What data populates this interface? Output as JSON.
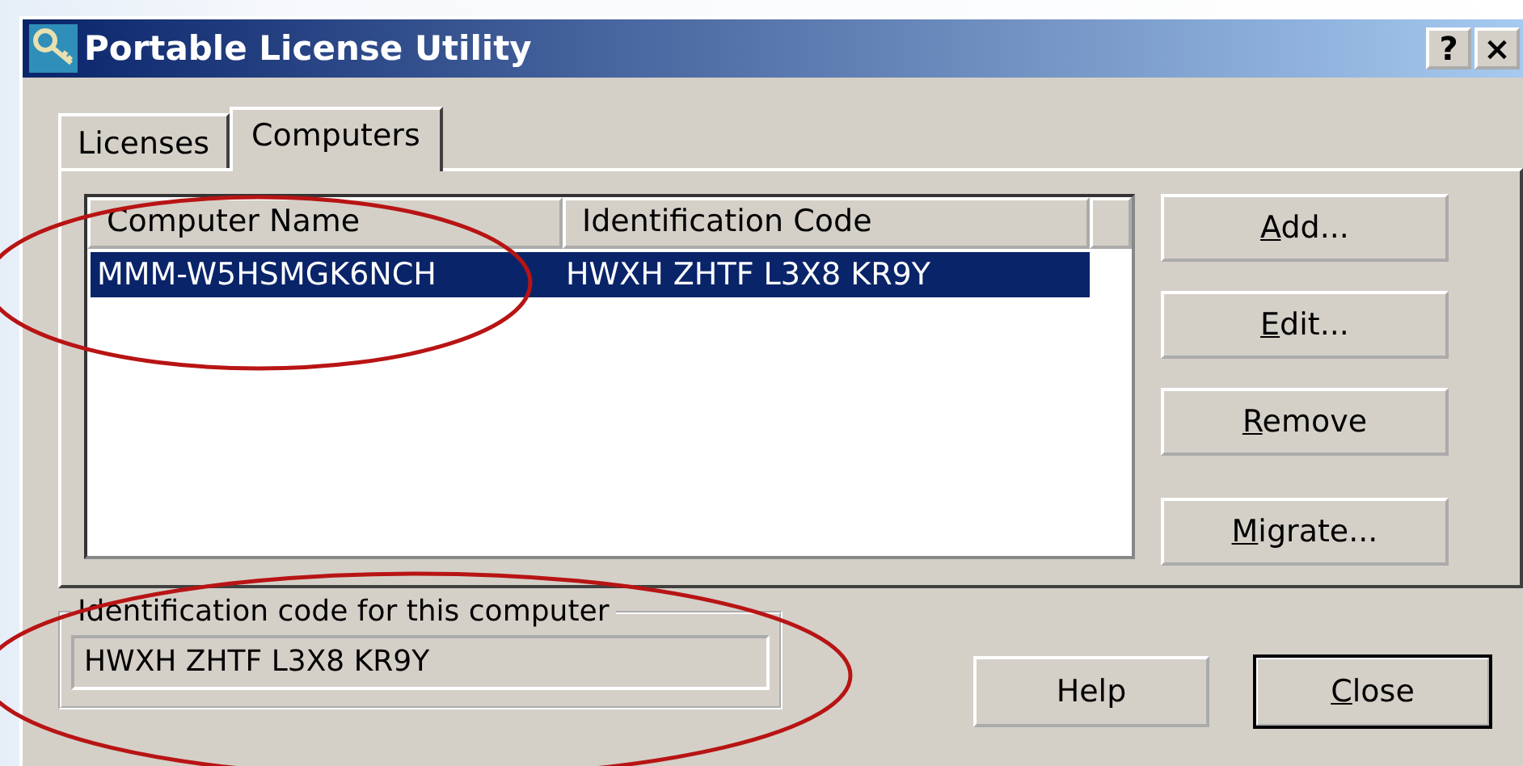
{
  "window": {
    "title": "Portable License Utility",
    "help_button": "?",
    "close_button": "×"
  },
  "tabs": [
    {
      "label": "Licenses",
      "selected": false
    },
    {
      "label": "Computers",
      "selected": true
    }
  ],
  "list": {
    "columns": [
      "Computer Name",
      "Identification Code"
    ],
    "rows": [
      {
        "cells": [
          "MMM-W5HSMGK6NCH",
          "HWXH ZHTF L3X8 KR9Y"
        ],
        "selected": true
      }
    ]
  },
  "side_buttons": [
    {
      "underlined": "A",
      "after": "dd..."
    },
    {
      "underlined": "E",
      "after": "dit..."
    },
    {
      "underlined": "R",
      "after": "emove"
    },
    {
      "underlined": "M",
      "after": "igrate..."
    }
  ],
  "group": {
    "label": "Identification code for this computer",
    "value": "HWXH ZHTF L3X8 KR9Y"
  },
  "bottom_buttons": [
    {
      "before": "Help",
      "default": false
    },
    {
      "underlined": "C",
      "after": "lose",
      "default": true
    }
  ]
}
